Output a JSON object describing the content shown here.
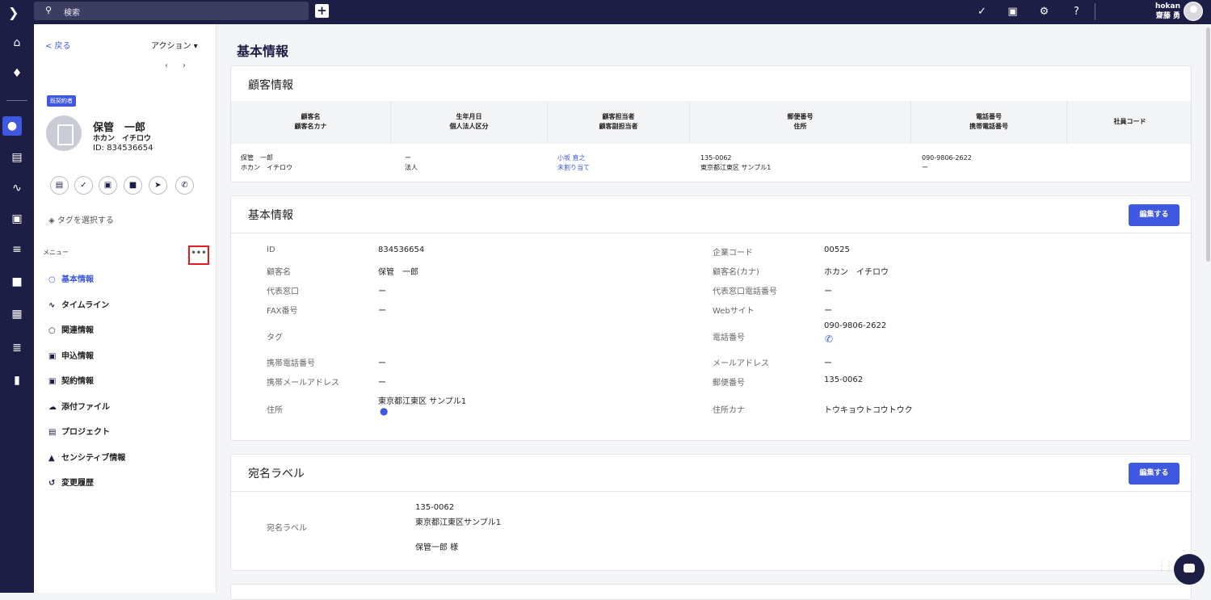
{
  "topbar": {
    "search_placeholder": "検索",
    "plus_label": "+",
    "user_id": "hokan",
    "user_name": "齋藤 勇"
  },
  "side": {
    "back_label": "< 戻る",
    "actions_label": "アクション ▾",
    "prev_label": "‹",
    "next_label": "›",
    "badge": "既契約者",
    "customer_name": "保管　一郎",
    "customer_kana": "ホカン　イチロウ",
    "customer_id": "ID: 834536654",
    "tag_select": "タグを選択する",
    "menu_label": "メニュー",
    "more_label": "•••",
    "menu_items": [
      {
        "label": "基本情報",
        "icon": "person-icon"
      },
      {
        "label": "タイムライン",
        "icon": "timeline-icon"
      },
      {
        "label": "関連情報",
        "icon": "people-icon"
      },
      {
        "label": "申込情報",
        "icon": "contact-card-icon"
      },
      {
        "label": "契約情報",
        "icon": "contract-card-icon"
      },
      {
        "label": "添付ファイル",
        "icon": "cloud-upload-icon"
      },
      {
        "label": "プロジェクト",
        "icon": "clipboard-icon"
      },
      {
        "label": "センシティブ情報",
        "icon": "lock-icon"
      },
      {
        "label": "変更履歴",
        "icon": "history-icon"
      }
    ]
  },
  "main": {
    "page_title": "基本情報",
    "customer_card": {
      "title": "顧客情報",
      "headers": [
        [
          "顧客名",
          "顧客名カナ"
        ],
        [
          "生年月日",
          "個人法人区分"
        ],
        [
          "顧客担当者",
          "顧客副担当者"
        ],
        [
          "郵便番号",
          "住所"
        ],
        [
          "電話番号",
          "携帯電話番号"
        ],
        [
          "社員コード",
          ""
        ]
      ],
      "row": [
        [
          "保管　一郎",
          "ホカン　イチロウ"
        ],
        [
          "ー",
          "法人"
        ],
        [
          "小坂 直之",
          "未割り当て"
        ],
        [
          "135-0062",
          "東京都江東区 サンプル1"
        ],
        [
          "090-9806-2622",
          "ー"
        ],
        [
          "",
          ""
        ]
      ]
    },
    "basic_card": {
      "title": "基本情報",
      "edit_label": "編集する",
      "left": [
        {
          "label": "ID",
          "value": "834536654"
        },
        {
          "label": "顧客名",
          "value": "保管　一郎"
        },
        {
          "label": "代表窓口",
          "value": "ー"
        },
        {
          "label": "FAX番号",
          "value": "ー"
        },
        {
          "label": "タグ",
          "value": ""
        },
        {
          "label": "携帯電話番号",
          "value": "ー"
        },
        {
          "label": "携帯メールアドレス",
          "value": "ー"
        },
        {
          "label": "住所",
          "value": "東京都江東区 サンプル1"
        }
      ],
      "right": [
        {
          "label": "企業コード",
          "value": "00525"
        },
        {
          "label": "顧客名(カナ)",
          "value": "ホカン　イチロウ"
        },
        {
          "label": "代表窓口電話番号",
          "value": "ー"
        },
        {
          "label": "Webサイト",
          "value": "ー"
        },
        {
          "label": "電話番号",
          "value": "090-9806-2622"
        },
        {
          "label": "メールアドレス",
          "value": "ー"
        },
        {
          "label": "郵便番号",
          "value": "135-0062"
        },
        {
          "label": "住所カナ",
          "value": "トウキョウトコウトウク"
        }
      ]
    },
    "label_card": {
      "title": "宛名ラベル",
      "edit_label": "編集する",
      "field_label": "宛名ラベル",
      "postal": "135-0062",
      "address": "東京都江東区サンプル1",
      "recipient": "保管一郎 様"
    }
  },
  "colors": {
    "navy": "#1c1e45",
    "accent": "#3f58e0",
    "highlight": "#e31b23"
  }
}
